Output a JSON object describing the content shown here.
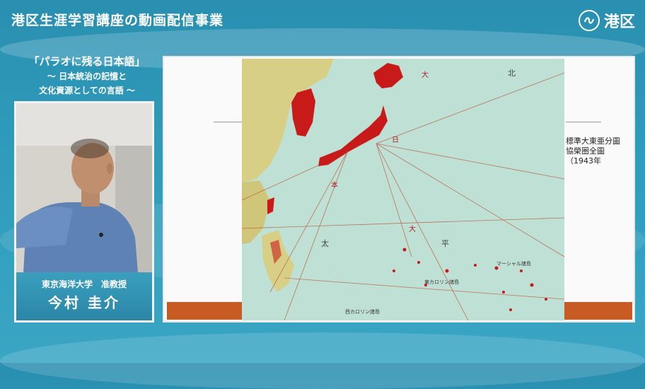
{
  "header": {
    "title": "港区生涯学習講座の動画配信事業"
  },
  "logo": {
    "text": "港区"
  },
  "lecture": {
    "title": "「パラオに残る日本語」",
    "subtitle_line1": "〜 日本統治の記憶と",
    "subtitle_line2": "文化資源としての言語 〜"
  },
  "speaker": {
    "affiliation": "東京海洋大学　准教授",
    "name": "今村 圭介"
  },
  "slide": {
    "caption_line1": "標準大東亜分圖",
    "caption_line2": "協榮圏全圖",
    "caption_line3": "（1943年",
    "map_labels": [
      "大",
      "日",
      "本",
      "大",
      "平",
      "北",
      "マーシャル諸島",
      "東カロリン諸島",
      "西カロリン諸島"
    ]
  },
  "colors": {
    "bg": "#2f9bbb",
    "stripe": "#c85a24",
    "sea": "#bfe0d4",
    "land": "#c91a1a"
  }
}
